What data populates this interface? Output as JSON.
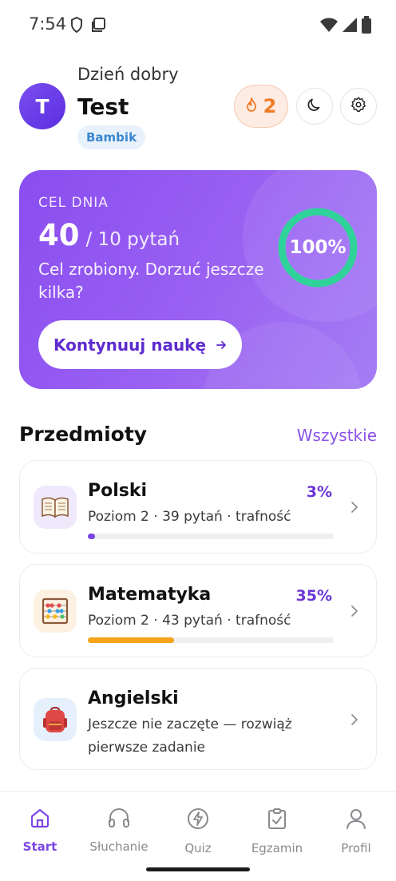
{
  "status_bar": {
    "time": "7:54"
  },
  "header": {
    "greeting": "Dzień dobry",
    "avatar_letter": "T",
    "username": "Test",
    "rank": "Bambik",
    "streak_count": "2"
  },
  "goal_card": {
    "label": "CEL DNIA",
    "answered": "40",
    "target": "/ 10 pytań",
    "message": "Cel zrobiony. Dorzuć jeszcze kilka?",
    "progress_text": "100%",
    "progress_fraction": 1.0,
    "continue_label": "Kontynuuj naukę",
    "ring_color": "#2fd39a"
  },
  "subjects_section": {
    "title": "Przedmioty",
    "see_all_label": "Wszystkie"
  },
  "subjects": [
    {
      "name": "Polski",
      "percent_label": "3%",
      "progress": 0.03,
      "meta": "Poziom 2 · 39 pytań · trafność",
      "icon": "book-icon",
      "bar_color": "#7b45e5"
    },
    {
      "name": "Matematyka",
      "percent_label": "35%",
      "progress": 0.35,
      "meta": "Poziom 2 · 43 pytań · trafność",
      "icon": "abacus-icon",
      "bar_color": "#f5a31a"
    },
    {
      "name": "Angielski",
      "description": "Jeszcze nie zaczęte — rozwiąż pierwsze zadanie",
      "icon": "backpack-icon"
    }
  ],
  "bottom_nav": [
    {
      "label": "Start",
      "icon": "home-icon",
      "active": true
    },
    {
      "label": "Słuchanie",
      "icon": "headphones-icon",
      "active": false
    },
    {
      "label": "Quiz",
      "icon": "lightning-icon",
      "active": false
    },
    {
      "label": "Egzamin",
      "icon": "clipboard-check-icon",
      "active": false
    },
    {
      "label": "Profil",
      "icon": "user-icon",
      "active": false
    }
  ],
  "colors": {
    "accent": "#8b52ea",
    "streak": "#f07b25",
    "rank": "#3b86cf"
  }
}
